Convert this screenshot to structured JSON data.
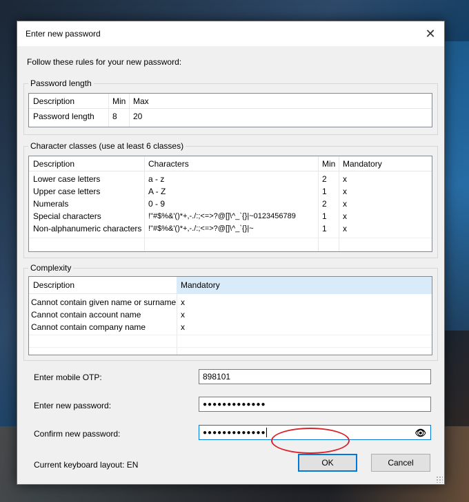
{
  "dialog": {
    "title": "Enter new password",
    "intro": "Follow these rules for your new password:"
  },
  "length_group": {
    "legend": "Password length",
    "headers": [
      "Description",
      "Min",
      "Max"
    ],
    "rows": [
      [
        "Password length",
        "8",
        "20"
      ]
    ]
  },
  "classes_group": {
    "legend": "Character classes (use at least 6 classes)",
    "headers": [
      "Description",
      "Characters",
      "Min",
      "Mandatory"
    ],
    "rows": [
      [
        "Lower case letters",
        "a - z",
        "2",
        "x"
      ],
      [
        "Upper case letters",
        "A - Z",
        "1",
        "x"
      ],
      [
        "Numerals",
        "0 - 9",
        "2",
        "x"
      ],
      [
        "Special characters",
        "!\"#$%&'()*+,-./:;<=>?@[]\\^_`{}|~0123456789",
        "1",
        "x"
      ],
      [
        "Non-alphanumeric characters",
        "!\"#$%&'()*+,-./:;<=>?@[]\\^_`{}|~",
        "1",
        "x"
      ]
    ]
  },
  "complexity_group": {
    "legend": "Complexity",
    "headers": [
      "Description",
      "Mandatory"
    ],
    "rows": [
      [
        "Cannot contain given name or surname",
        "x"
      ],
      [
        "Cannot contain account name",
        "x"
      ],
      [
        "Cannot contain company name",
        "x"
      ]
    ]
  },
  "form": {
    "otp_label": "Enter mobile OTP:",
    "otp_value": "898101",
    "new_label": "Enter new password:",
    "new_value": "●●●●●●●●●●●●●",
    "confirm_label": "Confirm new password:",
    "confirm_value": "●●●●●●●●●●●●●",
    "keyboard_label": "Current keyboard layout: EN"
  },
  "buttons": {
    "ok": "OK",
    "cancel": "Cancel"
  },
  "icons": {
    "close": "close-icon",
    "eye": "eye-icon"
  },
  "colors": {
    "accent": "#0078d7",
    "annotation_ring": "#d9232a",
    "header_highlight": "#d9ebf9"
  }
}
